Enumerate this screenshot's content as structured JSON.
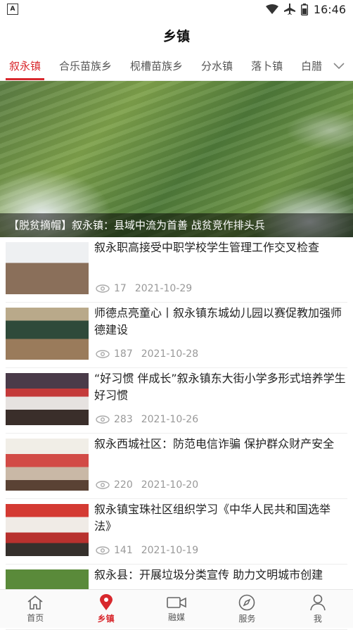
{
  "status": {
    "time": "16:46",
    "left_icon": "a-icon",
    "icons": [
      "wifi-icon",
      "airplane-icon",
      "battery-icon"
    ]
  },
  "header": {
    "title": "乡镇"
  },
  "tabs": [
    {
      "label": "叙永镇",
      "active": true
    },
    {
      "label": "合乐苗族乡"
    },
    {
      "label": "枧槽苗族乡"
    },
    {
      "label": "分水镇"
    },
    {
      "label": "落卜镇"
    },
    {
      "label": "白腊"
    }
  ],
  "banner": {
    "caption": "【脱贫摘帽】叙永镇：县域中流为首善 战贫竞作排头兵"
  },
  "news": [
    {
      "title": "叙永职高接受中职学校学生管理工作交叉检查",
      "views": "17",
      "date": "2021-10-29"
    },
    {
      "title": "师德点亮童心丨叙永镇东城幼儿园以赛促教加强师德建设",
      "views": "187",
      "date": "2021-10-28"
    },
    {
      "title": "“好习惯 伴成长”叙永镇东大街小学多形式培养学生好习惯",
      "views": "283",
      "date": "2021-10-26"
    },
    {
      "title": "叙永西城社区：防范电信诈骗 保护群众财产安全",
      "views": "220",
      "date": "2021-10-20"
    },
    {
      "title": "叙永镇宝珠社区组织学习《中华人民共和国选举法》",
      "views": "141",
      "date": "2021-10-19"
    },
    {
      "title": "叙永县：开展垃圾分类宣传 助力文明城市创建",
      "views": "",
      "date": ""
    }
  ],
  "bottom_nav": [
    {
      "label": "首页",
      "icon": "home-icon"
    },
    {
      "label": "乡镇",
      "icon": "location-pin-icon",
      "active": true
    },
    {
      "label": "融媒",
      "icon": "video-camera-icon"
    },
    {
      "label": "服务",
      "icon": "compass-icon"
    },
    {
      "label": "我",
      "icon": "user-icon"
    }
  ],
  "colors": {
    "accent": "#d8282d"
  }
}
